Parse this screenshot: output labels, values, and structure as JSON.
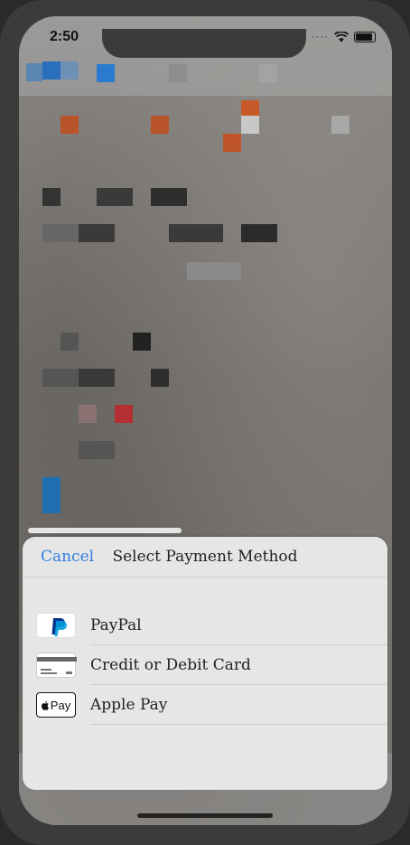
{
  "status_bar": {
    "time": "2:50",
    "signal": "····"
  },
  "sheet": {
    "cancel_label": "Cancel",
    "title": "Select Payment Method",
    "options": [
      {
        "label": "PayPal",
        "icon": "paypal-icon"
      },
      {
        "label": "Credit or Debit Card",
        "icon": "credit-card-icon"
      },
      {
        "label": "Apple Pay",
        "icon": "apple-pay-icon"
      }
    ],
    "apple_pay_badge": "Pay"
  },
  "colors": {
    "accent": "#2f7fe0",
    "paypal_dark": "#003087",
    "paypal_light": "#009cde"
  }
}
